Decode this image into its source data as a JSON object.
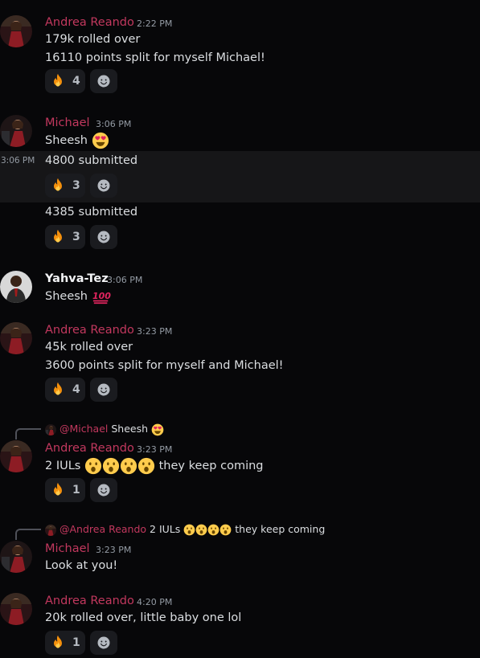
{
  "messages": [
    {
      "author": "Andrea Reando",
      "time": "2:22 PM",
      "lines": [
        "179k rolled over",
        "16110 points split for myself Michael!"
      ],
      "reaction": {
        "emoji": "fire",
        "count": "4"
      }
    },
    {
      "author": "Michael",
      "time": "3:06 PM",
      "lines": [
        "Sheesh"
      ]
    },
    {
      "hover_time": "3:06 PM",
      "lines": [
        "4800 submitted"
      ],
      "reaction": {
        "emoji": "fire",
        "count": "3"
      }
    },
    {
      "lines": [
        "4385 submitted"
      ],
      "reaction": {
        "emoji": "fire",
        "count": "3"
      }
    },
    {
      "author": "Yahva-Tez",
      "time": "3:06 PM",
      "lines": [
        "Sheesh"
      ]
    },
    {
      "author": "Andrea Reando",
      "time": "3:23 PM",
      "lines": [
        "45k rolled over",
        "3600 points split for myself and Michael!"
      ],
      "reaction": {
        "emoji": "fire",
        "count": "4"
      }
    },
    {
      "reply_to": {
        "mention": "@Michael",
        "text": "Sheesh"
      },
      "author": "Andrea Reando",
      "time": "3:23 PM",
      "lines": [
        "2  IULs",
        "they keep coming"
      ],
      "reaction": {
        "emoji": "fire",
        "count": "1"
      }
    },
    {
      "reply_to": {
        "mention": "@Andrea Reando",
        "text": "2  IULs",
        "text2": "they keep coming"
      },
      "author": "Michael",
      "time": "3:23 PM",
      "lines": [
        "Look at you!"
      ]
    },
    {
      "author": "Andrea Reando",
      "time": "4:20 PM",
      "lines": [
        "20k rolled over, little baby one lol"
      ],
      "reaction": {
        "emoji": "fire",
        "count": "1"
      }
    }
  ],
  "colors": {
    "background": "#070709",
    "author_accent": "#c2385e",
    "reaction_bg": "#1a1b1f"
  }
}
